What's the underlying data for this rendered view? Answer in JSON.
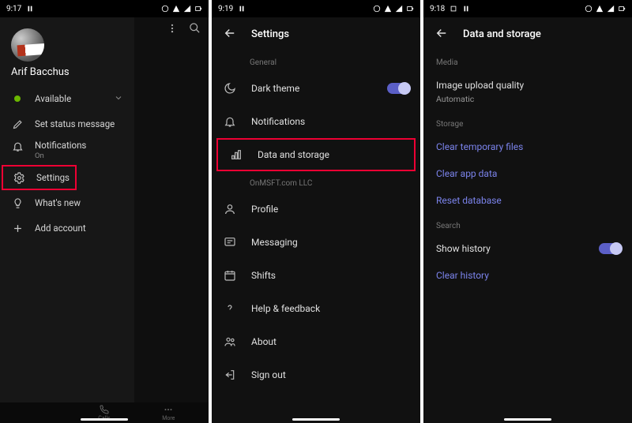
{
  "phone1": {
    "status_time": "9:17",
    "username": "Arif Bacchus",
    "available": "Available",
    "set_status": "Set status message",
    "notifications_label": "Notifications",
    "notifications_value": "On",
    "settings": "Settings",
    "whats_new": "What's new",
    "add_account": "Add account",
    "nav": {
      "calls": "Calls",
      "more": "More"
    }
  },
  "phone2": {
    "status_time": "9:19",
    "title": "Settings",
    "section_general": "General",
    "dark_theme": "Dark theme",
    "notifications": "Notifications",
    "data_storage": "Data and storage",
    "section_org": "OnMSFT.com LLC",
    "profile": "Profile",
    "messaging": "Messaging",
    "shifts": "Shifts",
    "help": "Help & feedback",
    "about": "About",
    "signout": "Sign out"
  },
  "phone3": {
    "status_time": "9:18",
    "title": "Data and storage",
    "section_media": "Media",
    "upload_quality": "Image upload quality",
    "upload_value": "Automatic",
    "section_storage": "Storage",
    "clear_temp": "Clear temporary files",
    "clear_app": "Clear app data",
    "reset_db": "Reset database",
    "section_search": "Search",
    "show_history": "Show history",
    "clear_history": "Clear history"
  }
}
